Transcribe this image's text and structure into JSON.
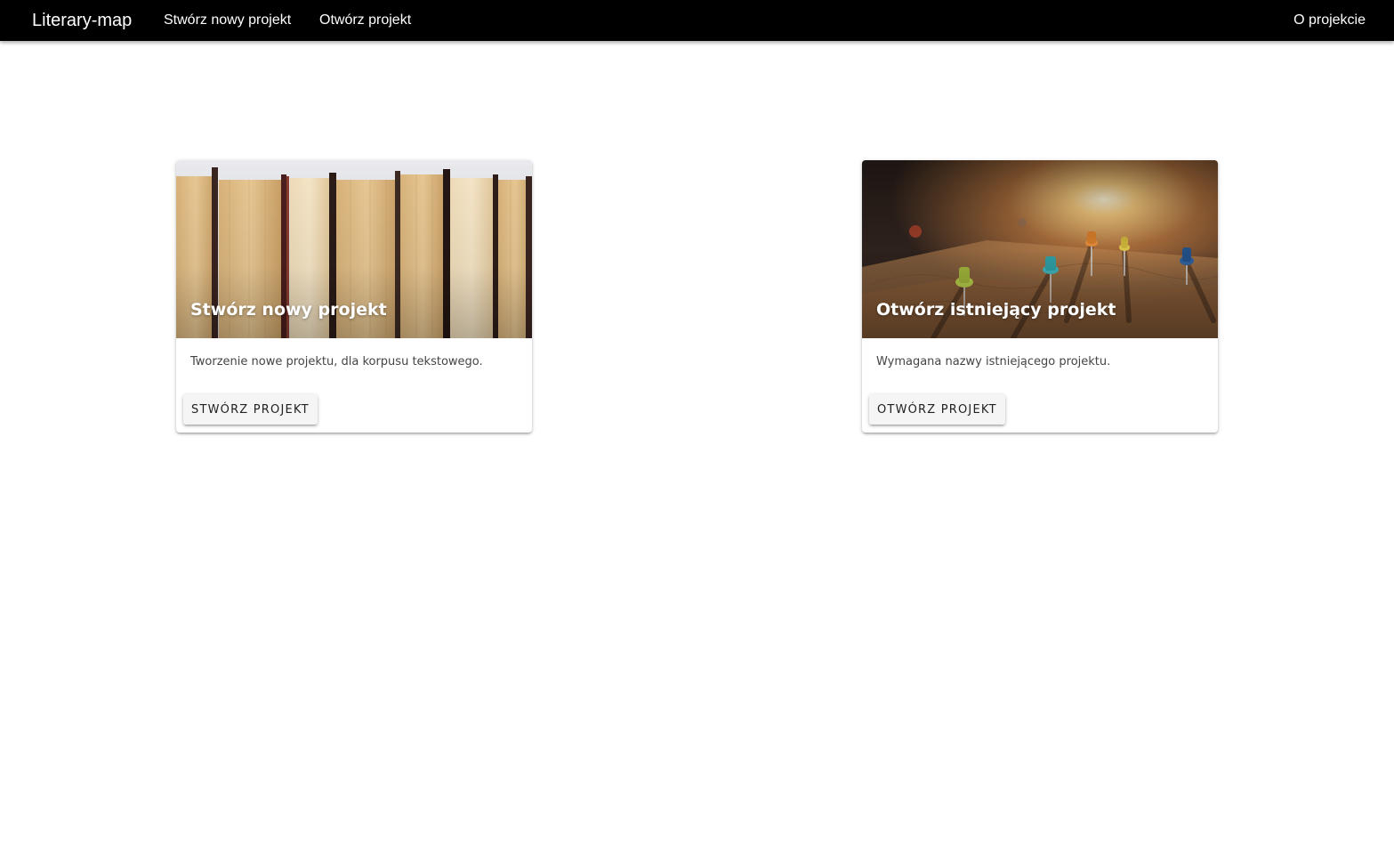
{
  "navbar": {
    "brand": "Literary-map",
    "links": {
      "new_project": "Stwórz nowy projekt",
      "open_project": "Otwórz projekt",
      "about": "O projekcie"
    }
  },
  "cards": {
    "create": {
      "title": "Stwórz nowy projekt",
      "description": "Tworzenie nowe projektu, dla korpusu tekstowego.",
      "button_label": "STWÓRZ PROJEKT",
      "image_icon": "books-image"
    },
    "open": {
      "title": "Otwórz istniejący projekt",
      "description": "Wymagana nazwy istniejącego projektu.",
      "button_label": "OTWÓRZ PROJEKT",
      "image_icon": "map-pins-image"
    }
  },
  "colors": {
    "navbar_bg": "#000000",
    "navbar_text": "#ffffff",
    "button_bg": "#f5f5f5"
  }
}
